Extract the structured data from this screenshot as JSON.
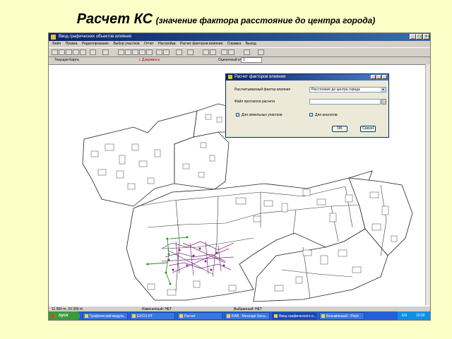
{
  "slide": {
    "title": "Расчет КС",
    "subtitle": "(значение фактора расстояние до центра города)"
  },
  "window": {
    "title": "Ввод графических объектов влияния",
    "min": "_",
    "max": "□",
    "close": "×"
  },
  "menu": [
    "Файл",
    "Правка",
    "Редактирование",
    "Выбор участков",
    "Отчет",
    "Настройки",
    "Расчет факторов влияния",
    "Справка",
    "Выход"
  ],
  "infobar": {
    "current_map_label": "Текущая Карта",
    "current_map_value": "г. Дзержинск",
    "class_label": "Оценочный класс",
    "class_value": "1"
  },
  "dialog": {
    "title": "Расчет факторов влияния",
    "factor_label": "Рассчитываемый фактор влияния",
    "factor_value": "Расстояние до центра города",
    "protocol_label": "Файл протокола расчета",
    "check1_label": "Для земельных участков",
    "check2_label": "Для аналогов",
    "ok": "OK",
    "cancel": "Cancel",
    "check_mark": "✓"
  },
  "status": {
    "coords": "11 000 m, 33 300 m",
    "changed": "Измененный: НЕТ",
    "selected": "Выбранный: НЕТ"
  },
  "taskbar": {
    "start": "пуск",
    "tasks": [
      "Графический модуль",
      "EXCO.HT",
      "Расчет",
      "KAB - Message Secu...",
      "Ввод графического о...",
      "Безымянный - Paint"
    ],
    "tray_lang": "EN",
    "tray_time": "19:02"
  },
  "colors": {
    "slide_bg": "#fefec8",
    "title_bar": "#0a246a",
    "taskbar": "#245edb",
    "start_button": "#3c9a3c",
    "map_road_purple": "#7a2a7a",
    "map_green": "#1a9a1a"
  }
}
